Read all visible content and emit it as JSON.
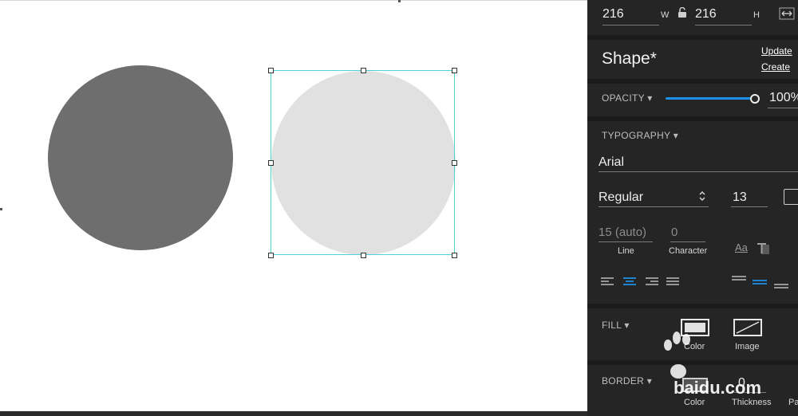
{
  "canvas": {
    "selection_color": "#4ed2d6",
    "dark_shape_color": "#6e6e6e",
    "light_shape_color": "#e1e1e1"
  },
  "dimensions": {
    "width": "216",
    "w_label": "W",
    "height": "216",
    "h_label": "H"
  },
  "shape": {
    "title": "Shape*",
    "update_label": "Update",
    "create_label": "Create"
  },
  "opacity": {
    "label": "OPACITY ▾",
    "value": "100%",
    "level": 1.0,
    "accent": "#1e8fe6"
  },
  "typography": {
    "label": "TYPOGRAPHY ▾",
    "font": "Arial",
    "style": "Regular",
    "size": "13",
    "line_value": "15 (auto)",
    "line_label": "Line",
    "character_value": "0",
    "character_label": "Character",
    "case_icon_text": "Aa",
    "active_align": "center"
  },
  "fill": {
    "label": "FILL ▾",
    "color_label": "Color",
    "image_label": "Image"
  },
  "border": {
    "label": "BORDER ▾",
    "color_label": "Color",
    "thickness_value": "0",
    "thickness_label": "Thickness",
    "third_label": "Pa"
  },
  "watermark": {
    "text": "baidu.com"
  }
}
